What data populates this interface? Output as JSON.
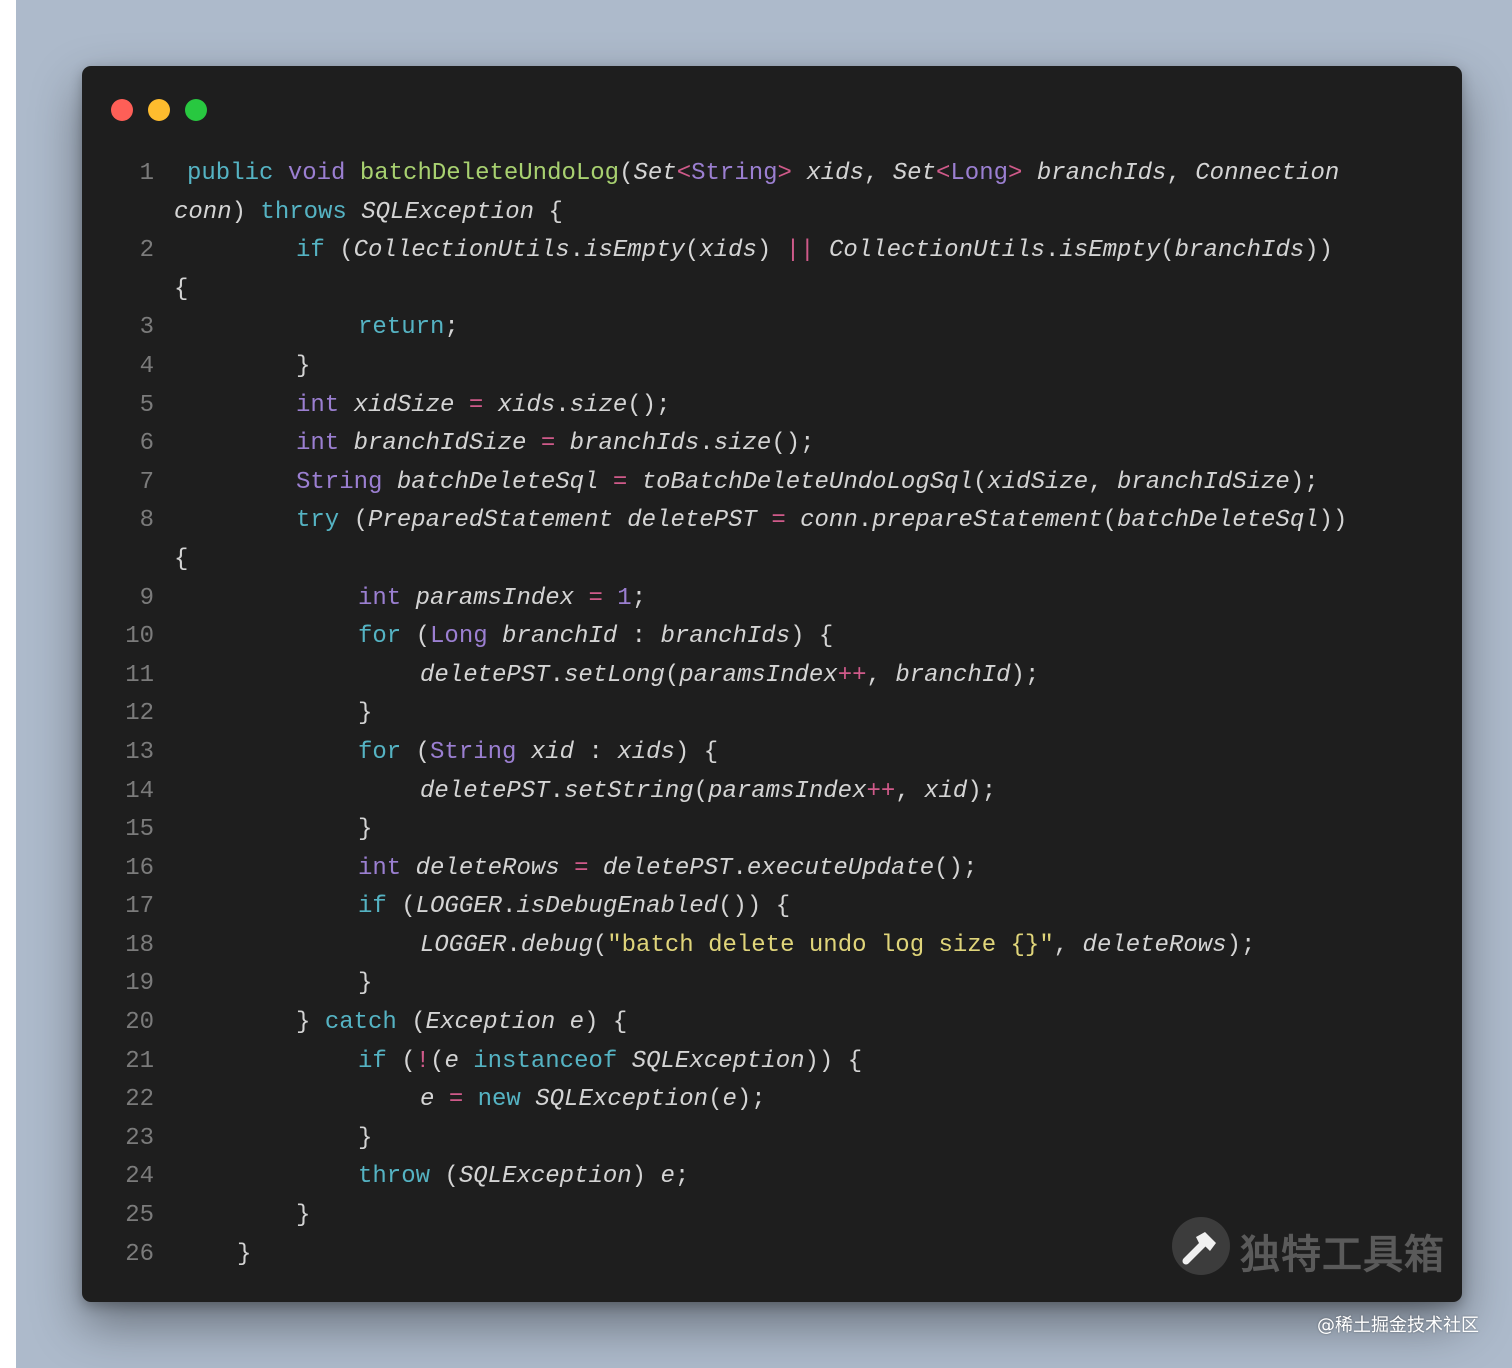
{
  "window": {
    "controls": [
      {
        "name": "close",
        "color": "#fe5f57"
      },
      {
        "name": "minimize",
        "color": "#febc2e"
      },
      {
        "name": "maximize",
        "color": "#28c840"
      }
    ]
  },
  "code": {
    "rows": [
      {
        "ln": "1",
        "indent": 0,
        "tokens": [
          [
            "k",
            "public"
          ],
          [
            "p",
            " "
          ],
          [
            "t",
            "void"
          ],
          [
            "p",
            " "
          ],
          [
            "f",
            "batchDeleteUndoLog"
          ],
          [
            "p",
            "("
          ],
          [
            "i",
            "Set"
          ],
          [
            "o",
            "<"
          ],
          [
            "t",
            "String"
          ],
          [
            "o",
            ">"
          ],
          [
            "p",
            " "
          ],
          [
            "i",
            "xids"
          ],
          [
            "p",
            ", "
          ],
          [
            "i",
            "Set"
          ],
          [
            "o",
            "<"
          ],
          [
            "t",
            "Long"
          ],
          [
            "o",
            ">"
          ],
          [
            "p",
            " "
          ],
          [
            "i",
            "branchIds"
          ],
          [
            "p",
            ", "
          ],
          [
            "i",
            "Connection"
          ]
        ]
      },
      {
        "ln": "",
        "indent": -1,
        "tokens": [
          [
            "i",
            "conn"
          ],
          [
            "p",
            ") "
          ],
          [
            "k",
            "throws"
          ],
          [
            "p",
            " "
          ],
          [
            "i",
            "SQLException"
          ],
          [
            "p",
            " {"
          ]
        ]
      },
      {
        "ln": "2",
        "indent": 2,
        "tokens": [
          [
            "k",
            "if"
          ],
          [
            "p",
            " ("
          ],
          [
            "i",
            "CollectionUtils"
          ],
          [
            "p",
            "."
          ],
          [
            "i",
            "isEmpty"
          ],
          [
            "p",
            "("
          ],
          [
            "i",
            "xids"
          ],
          [
            "p",
            ") "
          ],
          [
            "o",
            "||"
          ],
          [
            "p",
            " "
          ],
          [
            "i",
            "CollectionUtils"
          ],
          [
            "p",
            "."
          ],
          [
            "i",
            "isEmpty"
          ],
          [
            "p",
            "("
          ],
          [
            "i",
            "branchIds"
          ],
          [
            "p",
            "))"
          ]
        ]
      },
      {
        "ln": "",
        "indent": -1,
        "tokens": [
          [
            "p",
            "{"
          ]
        ]
      },
      {
        "ln": "3",
        "indent": 3,
        "tokens": [
          [
            "k",
            "return"
          ],
          [
            "p",
            ";"
          ]
        ]
      },
      {
        "ln": "4",
        "indent": 2,
        "tokens": [
          [
            "p",
            "}"
          ]
        ]
      },
      {
        "ln": "5",
        "indent": 2,
        "tokens": [
          [
            "t",
            "int"
          ],
          [
            "p",
            " "
          ],
          [
            "i",
            "xidSize"
          ],
          [
            "p",
            " "
          ],
          [
            "o",
            "="
          ],
          [
            "p",
            " "
          ],
          [
            "i",
            "xids"
          ],
          [
            "p",
            "."
          ],
          [
            "i",
            "size"
          ],
          [
            "p",
            "();"
          ]
        ]
      },
      {
        "ln": "6",
        "indent": 2,
        "tokens": [
          [
            "t",
            "int"
          ],
          [
            "p",
            " "
          ],
          [
            "i",
            "branchIdSize"
          ],
          [
            "p",
            " "
          ],
          [
            "o",
            "="
          ],
          [
            "p",
            " "
          ],
          [
            "i",
            "branchIds"
          ],
          [
            "p",
            "."
          ],
          [
            "i",
            "size"
          ],
          [
            "p",
            "();"
          ]
        ]
      },
      {
        "ln": "7",
        "indent": 2,
        "tokens": [
          [
            "t",
            "String"
          ],
          [
            "p",
            " "
          ],
          [
            "i",
            "batchDeleteSql"
          ],
          [
            "p",
            " "
          ],
          [
            "o",
            "="
          ],
          [
            "p",
            " "
          ],
          [
            "i",
            "toBatchDeleteUndoLogSql"
          ],
          [
            "p",
            "("
          ],
          [
            "i",
            "xidSize"
          ],
          [
            "p",
            ", "
          ],
          [
            "i",
            "branchIdSize"
          ],
          [
            "p",
            ");"
          ]
        ]
      },
      {
        "ln": "8",
        "indent": 2,
        "tokens": [
          [
            "k",
            "try"
          ],
          [
            "p",
            " ("
          ],
          [
            "i",
            "PreparedStatement"
          ],
          [
            "p",
            " "
          ],
          [
            "i",
            "deletePST"
          ],
          [
            "p",
            " "
          ],
          [
            "o",
            "="
          ],
          [
            "p",
            " "
          ],
          [
            "i",
            "conn"
          ],
          [
            "p",
            "."
          ],
          [
            "i",
            "prepareStatement"
          ],
          [
            "p",
            "("
          ],
          [
            "i",
            "batchDeleteSql"
          ],
          [
            "p",
            "))"
          ]
        ]
      },
      {
        "ln": "",
        "indent": -1,
        "tokens": [
          [
            "p",
            "{"
          ]
        ]
      },
      {
        "ln": "9",
        "indent": 3,
        "tokens": [
          [
            "t",
            "int"
          ],
          [
            "p",
            " "
          ],
          [
            "i",
            "paramsIndex"
          ],
          [
            "p",
            " "
          ],
          [
            "o",
            "="
          ],
          [
            "p",
            " "
          ],
          [
            "t",
            "1"
          ],
          [
            "p",
            ";"
          ]
        ]
      },
      {
        "ln": "10",
        "indent": 3,
        "tokens": [
          [
            "k",
            "for"
          ],
          [
            "p",
            " ("
          ],
          [
            "t",
            "Long"
          ],
          [
            "p",
            " "
          ],
          [
            "i",
            "branchId"
          ],
          [
            "p",
            " : "
          ],
          [
            "i",
            "branchIds"
          ],
          [
            "p",
            ") {"
          ]
        ]
      },
      {
        "ln": "11",
        "indent": 4,
        "tokens": [
          [
            "i",
            "deletePST"
          ],
          [
            "p",
            "."
          ],
          [
            "i",
            "setLong"
          ],
          [
            "p",
            "("
          ],
          [
            "i",
            "paramsIndex"
          ],
          [
            "o",
            "++"
          ],
          [
            "p",
            ", "
          ],
          [
            "i",
            "branchId"
          ],
          [
            "p",
            ");"
          ]
        ]
      },
      {
        "ln": "12",
        "indent": 3,
        "tokens": [
          [
            "p",
            "}"
          ]
        ]
      },
      {
        "ln": "13",
        "indent": 3,
        "tokens": [
          [
            "k",
            "for"
          ],
          [
            "p",
            " ("
          ],
          [
            "t",
            "String"
          ],
          [
            "p",
            " "
          ],
          [
            "i",
            "xid"
          ],
          [
            "p",
            " : "
          ],
          [
            "i",
            "xids"
          ],
          [
            "p",
            ") {"
          ]
        ]
      },
      {
        "ln": "14",
        "indent": 4,
        "tokens": [
          [
            "i",
            "deletePST"
          ],
          [
            "p",
            "."
          ],
          [
            "i",
            "setString"
          ],
          [
            "p",
            "("
          ],
          [
            "i",
            "paramsIndex"
          ],
          [
            "o",
            "++"
          ],
          [
            "p",
            ", "
          ],
          [
            "i",
            "xid"
          ],
          [
            "p",
            ");"
          ]
        ]
      },
      {
        "ln": "15",
        "indent": 3,
        "tokens": [
          [
            "p",
            "}"
          ]
        ]
      },
      {
        "ln": "16",
        "indent": 3,
        "tokens": [
          [
            "t",
            "int"
          ],
          [
            "p",
            " "
          ],
          [
            "i",
            "deleteRows"
          ],
          [
            "p",
            " "
          ],
          [
            "o",
            "="
          ],
          [
            "p",
            " "
          ],
          [
            "i",
            "deletePST"
          ],
          [
            "p",
            "."
          ],
          [
            "i",
            "executeUpdate"
          ],
          [
            "p",
            "();"
          ]
        ]
      },
      {
        "ln": "17",
        "indent": 3,
        "tokens": [
          [
            "k",
            "if"
          ],
          [
            "p",
            " ("
          ],
          [
            "i",
            "LOGGER"
          ],
          [
            "p",
            "."
          ],
          [
            "i",
            "isDebugEnabled"
          ],
          [
            "p",
            "()) {"
          ]
        ]
      },
      {
        "ln": "18",
        "indent": 4,
        "tokens": [
          [
            "i",
            "LOGGER"
          ],
          [
            "p",
            "."
          ],
          [
            "i",
            "debug"
          ],
          [
            "p",
            "("
          ],
          [
            "s",
            "\"batch delete undo log size {}\""
          ],
          [
            "p",
            ", "
          ],
          [
            "i",
            "deleteRows"
          ],
          [
            "p",
            ");"
          ]
        ]
      },
      {
        "ln": "19",
        "indent": 3,
        "tokens": [
          [
            "p",
            "}"
          ]
        ]
      },
      {
        "ln": "20",
        "indent": 2,
        "tokens": [
          [
            "p",
            "} "
          ],
          [
            "k",
            "catch"
          ],
          [
            "p",
            " ("
          ],
          [
            "i",
            "Exception"
          ],
          [
            "p",
            " "
          ],
          [
            "i",
            "e"
          ],
          [
            "p",
            ") {"
          ]
        ]
      },
      {
        "ln": "21",
        "indent": 3,
        "tokens": [
          [
            "k",
            "if"
          ],
          [
            "p",
            " ("
          ],
          [
            "o",
            "!"
          ],
          [
            "p",
            "("
          ],
          [
            "i",
            "e"
          ],
          [
            "p",
            " "
          ],
          [
            "k",
            "instanceof"
          ],
          [
            "p",
            " "
          ],
          [
            "i",
            "SQLException"
          ],
          [
            "p",
            ")) {"
          ]
        ]
      },
      {
        "ln": "22",
        "indent": 4,
        "tokens": [
          [
            "i",
            "e"
          ],
          [
            "p",
            " "
          ],
          [
            "o",
            "="
          ],
          [
            "p",
            " "
          ],
          [
            "k",
            "new"
          ],
          [
            "p",
            " "
          ],
          [
            "i",
            "SQLException"
          ],
          [
            "p",
            "("
          ],
          [
            "i",
            "e"
          ],
          [
            "p",
            ");"
          ]
        ]
      },
      {
        "ln": "23",
        "indent": 3,
        "tokens": [
          [
            "p",
            "}"
          ]
        ]
      },
      {
        "ln": "24",
        "indent": 3,
        "tokens": [
          [
            "k",
            "throw"
          ],
          [
            "p",
            " ("
          ],
          [
            "i",
            "SQLException"
          ],
          [
            "p",
            ") "
          ],
          [
            "i",
            "e"
          ],
          [
            "p",
            ";"
          ]
        ]
      },
      {
        "ln": "25",
        "indent": 2,
        "tokens": [
          [
            "p",
            "}"
          ]
        ]
      },
      {
        "ln": "26",
        "indent": 1,
        "tokens": [
          [
            "p",
            "}"
          ]
        ]
      }
    ]
  },
  "watermark": {
    "icon": "hammer-icon",
    "text": "独特工具箱"
  },
  "credit": "@稀土掘金技术社区"
}
